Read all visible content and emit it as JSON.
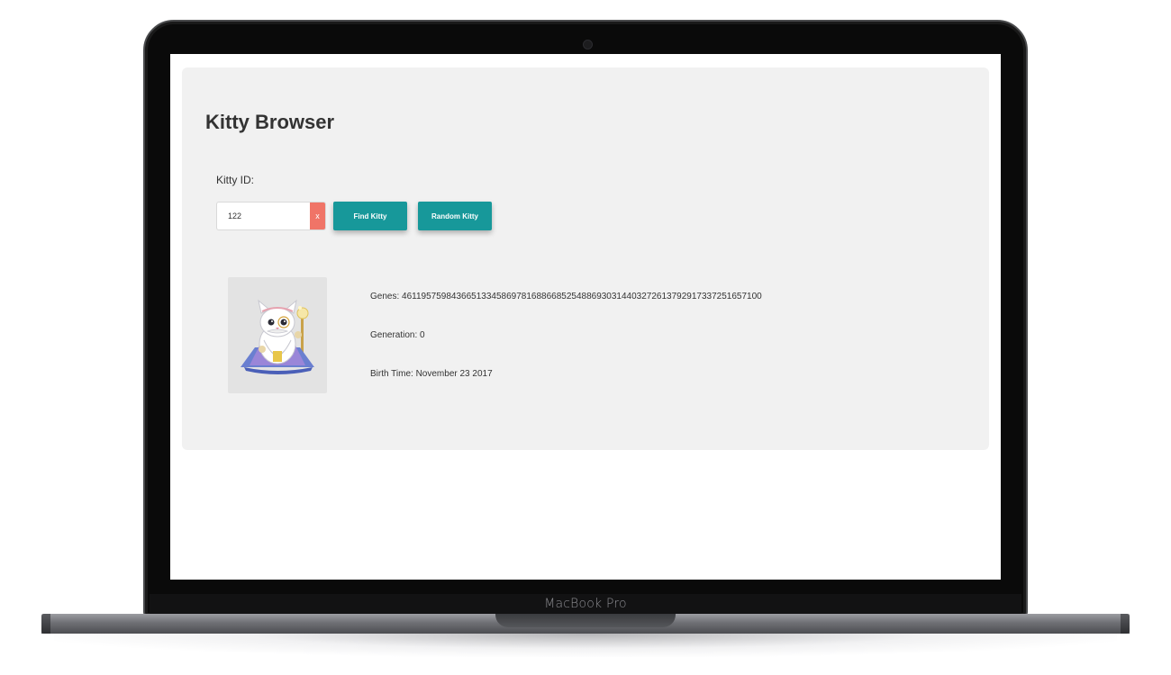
{
  "device": {
    "brand": "MacBook Pro"
  },
  "app": {
    "title": "Kitty Browser",
    "kitty_id_label": "Kitty ID:",
    "kitty_id_value": "122",
    "clear_label": "x",
    "find_button": "Find Kitty",
    "random_button": "Random Kitty"
  },
  "kitty": {
    "genes_label": "Genes:",
    "genes": "461195759843665133458697816886685254886930314403272613792917337251657100",
    "generation_label": "Generation:",
    "generation": "0",
    "birth_label": "Birth Time:",
    "birth_time": "November 23 2017",
    "image_icon": "cryptokitty-wizard-avatar"
  },
  "colors": {
    "accent": "#17989a",
    "clear": "#f07467",
    "card_bg": "#f1f1f1",
    "text": "#333333"
  }
}
